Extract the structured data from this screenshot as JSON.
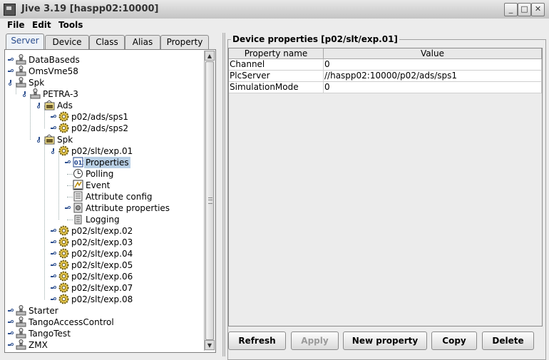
{
  "window": {
    "title": "Jive 3.19  [haspp02:10000]"
  },
  "menu": [
    "File",
    "Edit",
    "Tools"
  ],
  "tabs": [
    "Server",
    "Device",
    "Class",
    "Alias",
    "Property"
  ],
  "active_tab": "Server",
  "tree": [
    {
      "label": "DataBaseds",
      "icon": "server-icon",
      "level": 0
    },
    {
      "label": "OmsVme58",
      "icon": "server-icon",
      "level": 0
    },
    {
      "label": "Spk",
      "icon": "server-icon",
      "level": 0
    },
    {
      "label": "PETRA-3",
      "icon": "server-icon",
      "level": 1
    },
    {
      "label": "Ads",
      "icon": "class-icon",
      "level": 2
    },
    {
      "label": "p02/ads/sps1",
      "icon": "device-gear-icon",
      "level": 3
    },
    {
      "label": "p02/ads/sps2",
      "icon": "device-gear-icon",
      "level": 3
    },
    {
      "label": "Spk",
      "icon": "class-icon",
      "level": 2
    },
    {
      "label": "p02/slt/exp.01",
      "icon": "device-gear-icon",
      "level": 3
    },
    {
      "label": "Properties",
      "icon": "properties-icon",
      "level": 4
    },
    {
      "label": "Polling",
      "icon": "polling-icon",
      "level": 4
    },
    {
      "label": "Event",
      "icon": "event-icon",
      "level": 4
    },
    {
      "label": "Attribute config",
      "icon": "attribute-config-icon",
      "level": 4
    },
    {
      "label": "Attribute properties",
      "icon": "attribute-properties-icon",
      "level": 4
    },
    {
      "label": "Logging",
      "icon": "logging-icon",
      "level": 4
    },
    {
      "label": "p02/slt/exp.02",
      "icon": "device-gear-icon",
      "level": 3
    },
    {
      "label": "p02/slt/exp.03",
      "icon": "device-gear-icon",
      "level": 3
    },
    {
      "label": "p02/slt/exp.04",
      "icon": "device-gear-icon",
      "level": 3
    },
    {
      "label": "p02/slt/exp.05",
      "icon": "device-gear-icon",
      "level": 3
    },
    {
      "label": "p02/slt/exp.06",
      "icon": "device-gear-icon",
      "level": 3
    },
    {
      "label": "p02/slt/exp.07",
      "icon": "device-gear-icon",
      "level": 3
    },
    {
      "label": "p02/slt/exp.08",
      "icon": "device-gear-icon",
      "level": 3
    },
    {
      "label": "Starter",
      "icon": "server-icon",
      "level": 0
    },
    {
      "label": "TangoAccessControl",
      "icon": "server-icon",
      "level": 0
    },
    {
      "label": "TangoTest",
      "icon": "server-icon",
      "level": 0
    },
    {
      "label": "ZMX",
      "icon": "server-icon",
      "level": 0
    }
  ],
  "selected_node": "Properties",
  "panel": {
    "title": "Device properties [p02/slt/exp.01]",
    "columns": [
      "Property name",
      "Value"
    ],
    "rows": [
      [
        "Channel",
        "0"
      ],
      [
        "PlcServer",
        "//haspp02:10000/p02/ads/sps1"
      ],
      [
        "SimulationMode",
        "0"
      ]
    ]
  },
  "buttons": [
    {
      "label": "Refresh",
      "enabled": true
    },
    {
      "label": "Apply",
      "enabled": false
    },
    {
      "label": "New property",
      "enabled": true
    },
    {
      "label": "Copy",
      "enabled": true
    },
    {
      "label": "Delete",
      "enabled": true
    }
  ],
  "colors": {
    "selection": "#b8cfe5",
    "tab_accent": "#2a4d8e"
  }
}
